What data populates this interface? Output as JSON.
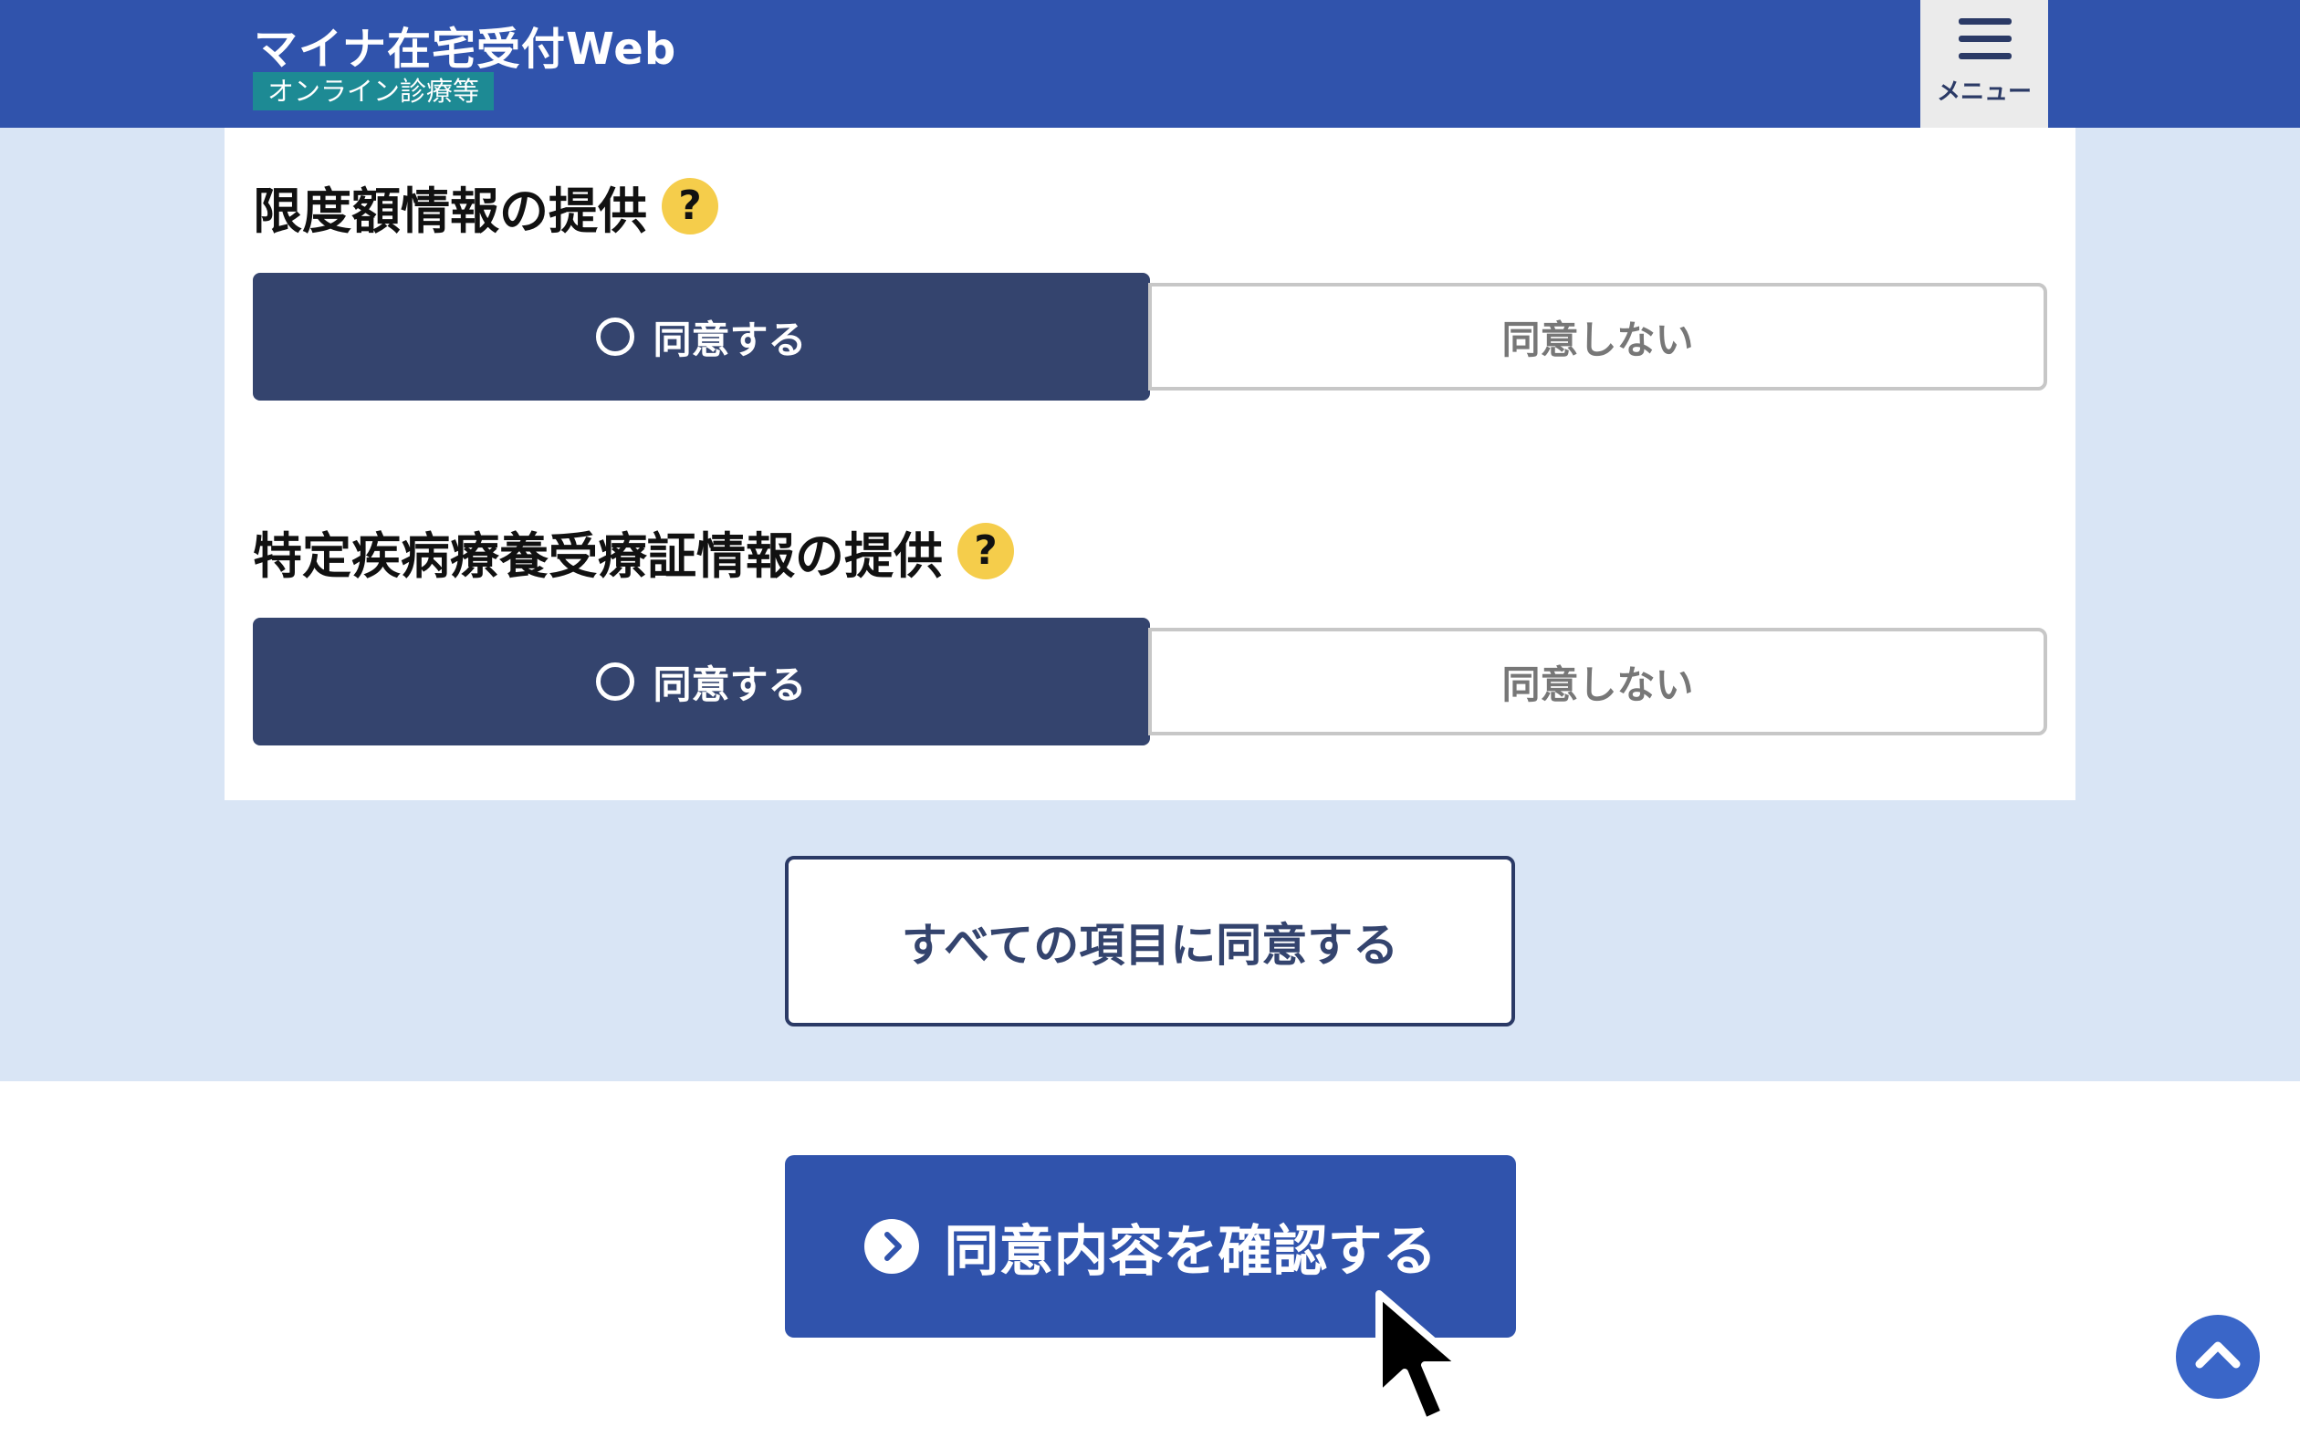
{
  "header": {
    "title": "マイナ在宅受付Web",
    "badge": "オンライン診療等",
    "menu_label": "メニュー",
    "menu_icon": "hamburger-icon",
    "background_color": "#3053ac"
  },
  "sections": [
    {
      "title": "限度額情報の提供",
      "help_icon_text": "?",
      "agree_label": "同意する",
      "disagree_label": "同意しない",
      "selected": "agree"
    },
    {
      "title": "特定疾病療養受療証情報の提供",
      "help_icon_text": "?",
      "agree_label": "同意する",
      "disagree_label": "同意しない",
      "selected": "agree"
    }
  ],
  "agree_all_label": "すべての項目に同意する",
  "confirm_label": "同意内容を確認する",
  "icons": {
    "help": "question-icon",
    "confirm": "chevron-right-circle-icon",
    "scroll_top": "chevron-up-icon",
    "cursor": "mouse-pointer-icon"
  },
  "colors": {
    "primary": "#3053ac",
    "selected_option": "#34446e",
    "help_badge": "#f5cd4b",
    "band_background": "#d9e5f5",
    "badge_teal": "#1d8a94"
  }
}
